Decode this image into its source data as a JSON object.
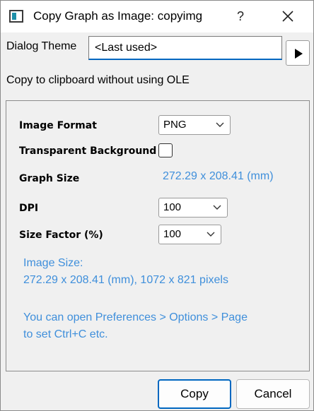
{
  "window": {
    "title": "Copy Graph as Image: copyimg",
    "help_label": "?"
  },
  "theme": {
    "label": "Dialog Theme",
    "value": "<Last used>"
  },
  "ole_text": "Copy to clipboard without using OLE",
  "form": {
    "image_format": {
      "label": "Image Format",
      "value": "PNG"
    },
    "transparent": {
      "label": "Transparent Background",
      "checked": false
    },
    "graph_size": {
      "label": "Graph Size",
      "value": "272.29 x 208.41 (mm)"
    },
    "dpi": {
      "label": "DPI",
      "value": "100"
    },
    "size_factor": {
      "label": "Size Factor (%)",
      "value": "100"
    }
  },
  "info": {
    "image_size_label": "Image Size:",
    "image_size_value": "272.29 x 208.41 (mm), 1072 x 821 pixels",
    "hint_line1": "You can open Preferences > Options > Page",
    "hint_line2": "to set Ctrl+C etc."
  },
  "buttons": {
    "copy": "Copy",
    "cancel": "Cancel"
  },
  "colors": {
    "accent": "#0067c0",
    "info_text": "#3f8fdb"
  }
}
